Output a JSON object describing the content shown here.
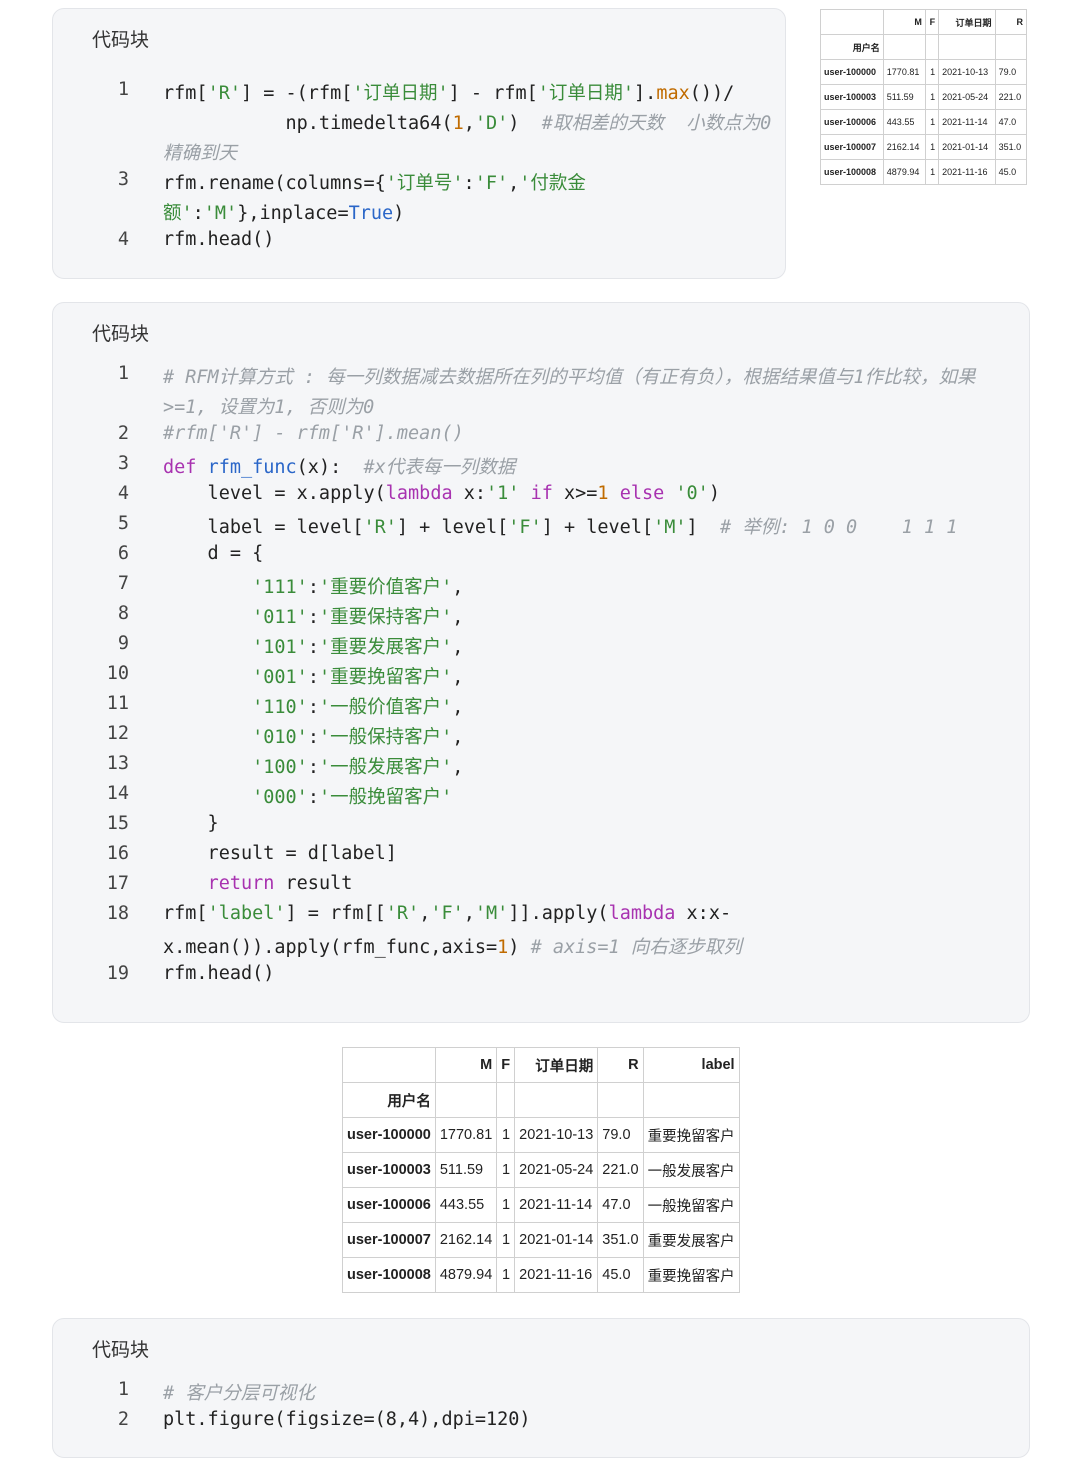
{
  "block1": {
    "title": "代码块",
    "lines": [
      {
        "n": "1",
        "html": "rfm[<span class=\"s\">'R'</span>] = -(rfm[<span class=\"s\">'订单日期'</span>] - rfm[<span class=\"s\">'订单日期'</span>].<span class=\"n\">max</span>())/"
      },
      {
        "n": "",
        "html": "           np.timedelta64(<span class=\"n\">1</span>,<span class=\"s\">'D'</span>)  <span class=\"c\">#取相差的天数  小数点为0</span>"
      },
      {
        "n": "",
        "html": "<span class=\"c\">精确到天</span>"
      },
      {
        "n": "3",
        "html": "rfm.rename(columns={<span class=\"s\">'订单号'</span>:<span class=\"s\">'F'</span>,<span class=\"s\">'付款金</span>"
      },
      {
        "n": "",
        "html": "<span class=\"s\">额'</span>:<span class=\"s\">'M'</span>},inplace=<span class=\"b\">True</span>)"
      },
      {
        "n": "4",
        "html": "rfm.head()"
      }
    ]
  },
  "block2": {
    "title": "代码块",
    "lines": [
      {
        "n": "1",
        "html": "<span class=\"c\"># RFM计算方式 : 每一列数据减去数据所在列的平均值（有正有负），根据结果值与1作比较，如果</span>"
      },
      {
        "n": "",
        "html": "<span class=\"c\">&gt;=1, 设置为1, 否则为0</span>"
      },
      {
        "n": "2",
        "html": "<span class=\"c\">#rfm['R'] - rfm['R'].mean()</span>"
      },
      {
        "n": "3",
        "html": "<span class=\"k\">def</span> <span class=\"f\">rfm_func</span>(x):  <span class=\"c\">#x代表每一列数据</span>"
      },
      {
        "n": "4",
        "html": "    level = x.apply(<span class=\"k\">lambda</span> x:<span class=\"s\">'1'</span> <span class=\"k\">if</span> x&gt;=<span class=\"n\">1</span> <span class=\"k\">else</span> <span class=\"s\">'0'</span>)"
      },
      {
        "n": "5",
        "html": "    label = level[<span class=\"s\">'R'</span>] + level[<span class=\"s\">'F'</span>] + level[<span class=\"s\">'M'</span>]  <span class=\"c\"># 举例: 1 0 0    1 1 1</span>"
      },
      {
        "n": "6",
        "html": "    d = {"
      },
      {
        "n": "7",
        "html": "        <span class=\"s\">'111'</span>:<span class=\"s\">'重要价值客户'</span>,"
      },
      {
        "n": "8",
        "html": "        <span class=\"s\">'011'</span>:<span class=\"s\">'重要保持客户'</span>,"
      },
      {
        "n": "9",
        "html": "        <span class=\"s\">'101'</span>:<span class=\"s\">'重要发展客户'</span>,"
      },
      {
        "n": "10",
        "html": "        <span class=\"s\">'001'</span>:<span class=\"s\">'重要挽留客户'</span>,"
      },
      {
        "n": "11",
        "html": "        <span class=\"s\">'110'</span>:<span class=\"s\">'一般价值客户'</span>,"
      },
      {
        "n": "12",
        "html": "        <span class=\"s\">'010'</span>:<span class=\"s\">'一般保持客户'</span>,"
      },
      {
        "n": "13",
        "html": "        <span class=\"s\">'100'</span>:<span class=\"s\">'一般发展客户'</span>,"
      },
      {
        "n": "14",
        "html": "        <span class=\"s\">'000'</span>:<span class=\"s\">'一般挽留客户'</span>"
      },
      {
        "n": "15",
        "html": "    }"
      },
      {
        "n": "16",
        "html": "    result = d[label]"
      },
      {
        "n": "17",
        "html": "    <span class=\"k\">return</span> result"
      },
      {
        "n": "18",
        "html": "rfm[<span class=\"s\">'label'</span>] = rfm[[<span class=\"s\">'R'</span>,<span class=\"s\">'F'</span>,<span class=\"s\">'M'</span>]].apply(<span class=\"k\">lambda</span> x:x-"
      },
      {
        "n": "",
        "html": "x.mean()).apply(rfm_func,axis=<span class=\"n\">1</span>) <span class=\"c\"># axis=1 向右逐步取列</span>"
      },
      {
        "n": "19",
        "html": "rfm.head()"
      }
    ]
  },
  "block3": {
    "title": "代码块",
    "lines": [
      {
        "n": "1",
        "html": "<span class=\"c\"># 客户分层可视化</span>"
      },
      {
        "n": "2",
        "html": "plt.figure(figsize=(8,4),dpi=120)"
      }
    ]
  },
  "table_small": {
    "columns": [
      "M",
      "F",
      "订单日期",
      "R"
    ],
    "index_name": "用户名",
    "rows": [
      {
        "user": "user-100000",
        "M": "1770.81",
        "F": "1",
        "date": "2021-10-13",
        "R": "79.0"
      },
      {
        "user": "user-100003",
        "M": "511.59",
        "F": "1",
        "date": "2021-05-24",
        "R": "221.0"
      },
      {
        "user": "user-100006",
        "M": "443.55",
        "F": "1",
        "date": "2021-11-14",
        "R": "47.0"
      },
      {
        "user": "user-100007",
        "M": "2162.14",
        "F": "1",
        "date": "2021-01-14",
        "R": "351.0"
      },
      {
        "user": "user-100008",
        "M": "4879.94",
        "F": "1",
        "date": "2021-11-16",
        "R": "45.0"
      }
    ]
  },
  "table_big": {
    "columns": [
      "M",
      "F",
      "订单日期",
      "R",
      "label"
    ],
    "index_name": "用户名",
    "rows": [
      {
        "user": "user-100000",
        "M": "1770.81",
        "F": "1",
        "date": "2021-10-13",
        "R": "79.0",
        "label": "重要挽留客户"
      },
      {
        "user": "user-100003",
        "M": "511.59",
        "F": "1",
        "date": "2021-05-24",
        "R": "221.0",
        "label": "一般发展客户"
      },
      {
        "user": "user-100006",
        "M": "443.55",
        "F": "1",
        "date": "2021-11-14",
        "R": "47.0",
        "label": "一般挽留客户"
      },
      {
        "user": "user-100007",
        "M": "2162.14",
        "F": "1",
        "date": "2021-01-14",
        "R": "351.0",
        "label": "重要发展客户"
      },
      {
        "user": "user-100008",
        "M": "4879.94",
        "F": "1",
        "date": "2021-11-16",
        "R": "45.0",
        "label": "重要挽留客户"
      }
    ]
  }
}
